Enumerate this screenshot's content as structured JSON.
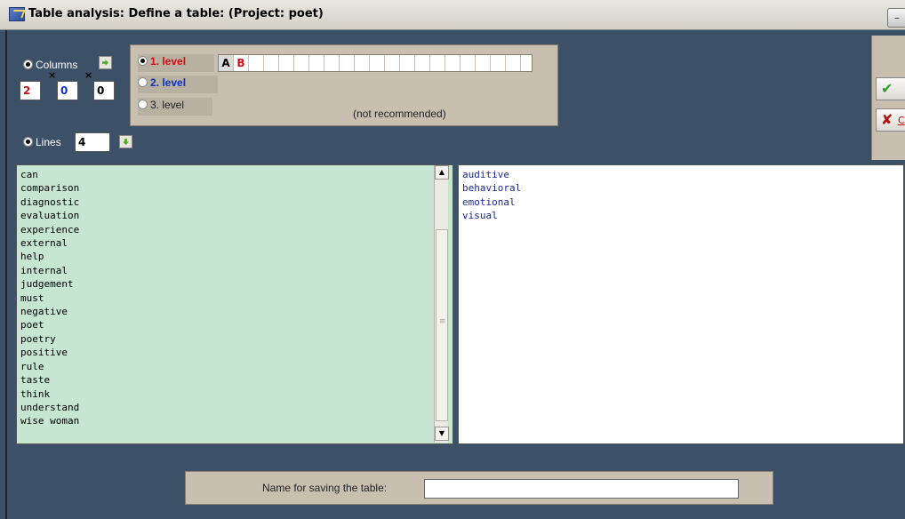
{
  "window": {
    "title": "Table analysis: Define a table: (Project: poet)",
    "minimize_glyph": "–"
  },
  "columns": {
    "label": "Columns",
    "selected": true,
    "values": [
      "2",
      "0",
      "0"
    ],
    "value_colors": [
      "#d01010",
      "#1030c0",
      "#000000"
    ],
    "times_glyph": "×"
  },
  "lines": {
    "label": "Lines",
    "selected": true,
    "value": "4"
  },
  "levels": {
    "items": [
      {
        "label": "1. level",
        "color": "#d01010",
        "selected": true
      },
      {
        "label": "2. level",
        "color": "#1030c0",
        "selected": false
      },
      {
        "label": "3. level",
        "color": "#222222",
        "selected": false
      }
    ],
    "grid_cells": [
      "A",
      "B"
    ],
    "grid_colors": [
      "#000000",
      "#d01010"
    ],
    "note": "(not recommended)"
  },
  "side_buttons": {
    "ok_icon": "check-icon",
    "ok_glyph": "✔",
    "cancel_icon": "close-icon",
    "cancel_glyph": "✘",
    "cancel_label_partial": "C"
  },
  "left_list": {
    "items": [
      "can",
      "comparison",
      "diagnostic",
      "evaluation",
      "experience",
      "external",
      "help",
      "internal",
      "judgement",
      "must",
      "negative",
      "poet",
      "poetry",
      "positive",
      "rule",
      "taste",
      "think",
      "understand",
      "wise woman"
    ]
  },
  "right_list": {
    "items": [
      "auditive",
      "behavioral",
      "emotional",
      "visual"
    ]
  },
  "scroll": {
    "up_glyph": "▲",
    "down_glyph": "▼"
  },
  "save": {
    "label": "Name for saving the table:",
    "value": ""
  }
}
